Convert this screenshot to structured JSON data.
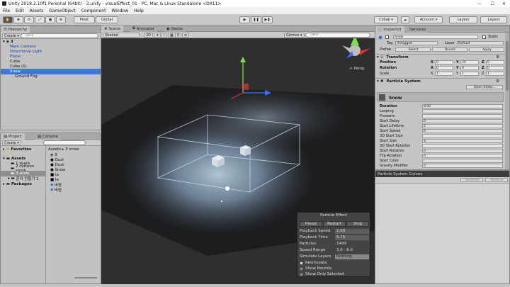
{
  "window": {
    "title": "Unity 2018.2.10f1 Personal (64bit) - 3.unity - visualEffect_01 - PC, Mac & Linux Standalone <DX11>"
  },
  "menu": [
    "File",
    "Edit",
    "Assets",
    "GameObject",
    "Component",
    "Window",
    "Help"
  ],
  "toolbar": {
    "pivot": "Pivot",
    "global": "Global",
    "collab": "Collab ▾",
    "account": "Account ▾",
    "layers": "Layers",
    "layout": "Layout",
    "play_icons": [
      "▶",
      "❚❚",
      "▶❚"
    ]
  },
  "hierarchy": {
    "tab": "Hierarchy",
    "create": "Create ▾",
    "search_placeholder": "Q▾All",
    "scene": "3",
    "items": [
      {
        "label": "Main Camera",
        "indent": 1
      },
      {
        "label": "Directional Light",
        "indent": 1
      },
      {
        "label": "Plane",
        "indent": 1
      },
      {
        "label": "Cube",
        "indent": 1
      },
      {
        "label": "Cube (1)",
        "indent": 1
      },
      {
        "label": "Snow",
        "indent": 1,
        "selected": true
      },
      {
        "label": "Ground Fog",
        "indent": 2
      }
    ]
  },
  "project": {
    "tab_project": "Project",
    "tab_console": "Console",
    "create": "Create ▾",
    "favorites": "Favorites",
    "tree": [
      {
        "label": "Assets",
        "bold": true
      },
      {
        "label": "1 spark",
        "indent": 1
      },
      {
        "label": "2 cartoon smok",
        "indent": 1
      },
      {
        "label": "3 snow",
        "indent": 1,
        "selected": true
      },
      {
        "label": "혼자 만들기 1",
        "indent": 1
      },
      {
        "label": "Packages",
        "bold": true
      }
    ],
    "breadcrumb": "Assets ▸ 3 snow",
    "files": [
      "3",
      "Dust",
      "Dust",
      "Snow",
      "la",
      "le",
      "바람",
      "바람"
    ]
  },
  "scene": {
    "tab_scene": "Scene",
    "tab_animator": "Animator",
    "tab_game": "Game",
    "shading": "Shaded",
    "mode_2d": "2D",
    "gizmos": "Gizmos ▾",
    "search_placeholder": "Q▾All",
    "persp": "< Persp"
  },
  "particle_effect": {
    "title": "Particle Effect",
    "buttons": [
      "Pause",
      "Restart",
      "Stop"
    ],
    "rows": [
      {
        "label": "Playback Speed",
        "value": "1.00"
      },
      {
        "label": "Playback Time",
        "value": "5.76"
      },
      {
        "label": "Particles",
        "value": "1499"
      },
      {
        "label": "Speed Range",
        "value": "3.0 - 6.0"
      },
      {
        "label": "Simulate Layers",
        "value": "Nothing"
      }
    ],
    "checks": [
      "Resimulate",
      "Show Bounds",
      "Show Only Selected"
    ]
  },
  "inspector": {
    "tab_inspector": "Inspector",
    "tab_services": "Services",
    "name": "Snow",
    "static": "Static",
    "tag_label": "Tag",
    "tag": "Untagged",
    "layer_label": "Layer",
    "layer": "Default",
    "prefab": "Prefab",
    "prefab_buttons": [
      "Select",
      "Revert",
      "Apply"
    ],
    "transform": {
      "title": "Transform",
      "position": {
        "label": "Position",
        "x": "0",
        "y": "20",
        "z": "0"
      },
      "rotation": {
        "label": "Rotation",
        "x": "0",
        "y": "0",
        "z": "0"
      },
      "scale": {
        "label": "Scale",
        "x": "1",
        "y": "1",
        "z": "1"
      }
    },
    "particle_system": {
      "title": "Particle System",
      "open_editor": "Open Editor...",
      "name": "Snow",
      "props": [
        {
          "label": "Duration",
          "value": "8.00",
          "bold": true
        },
        {
          "label": "Looping",
          "value": ""
        },
        {
          "label": "Prewarm",
          "value": ""
        },
        {
          "label": "Start Delay",
          "value": "0"
        },
        {
          "label": "Start Lifetime",
          "value": "5"
        },
        {
          "label": "Start Speed",
          "value": "0"
        },
        {
          "label": "3D Start Size",
          "value": ""
        },
        {
          "label": "Start Size",
          "value": "3"
        },
        {
          "label": "3D Start Rotation",
          "value": ""
        },
        {
          "label": "Start Rotation",
          "value": "0"
        },
        {
          "label": "Flip Rotation",
          "value": "0"
        },
        {
          "label": "Start Color",
          "value": ""
        },
        {
          "label": "Gravity Modifier",
          "value": "0"
        }
      ]
    },
    "curves": {
      "title": "Particle System Curves",
      "optimize": "Optimize",
      "remove": "Remove"
    }
  }
}
